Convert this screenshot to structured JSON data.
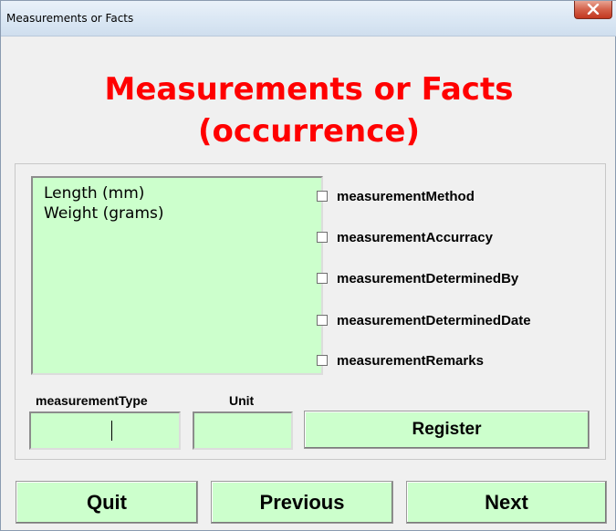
{
  "window": {
    "title": "Measurements or Facts"
  },
  "heading": {
    "line1": "Measurements or Facts",
    "line2": "(occurrence)"
  },
  "measurement_list": {
    "items": [
      "Length (mm)",
      "Weight (grams)"
    ]
  },
  "checkboxes": [
    {
      "label": "measurementMethod",
      "checked": false
    },
    {
      "label": "measurementAccurracy",
      "checked": false
    },
    {
      "label": "measurementDeterminedBy",
      "checked": false
    },
    {
      "label": "measurementDeterminedDate",
      "checked": false
    },
    {
      "label": "measurementRemarks",
      "checked": false
    }
  ],
  "fields": {
    "measurement_type_label": "measurementType",
    "measurement_type_value": "",
    "unit_label": "Unit",
    "unit_value": ""
  },
  "buttons": {
    "register": "Register",
    "quit": "Quit",
    "previous": "Previous",
    "next": "Next"
  },
  "colors": {
    "heading": "#ff0000",
    "control_background": "#ccffcc"
  }
}
